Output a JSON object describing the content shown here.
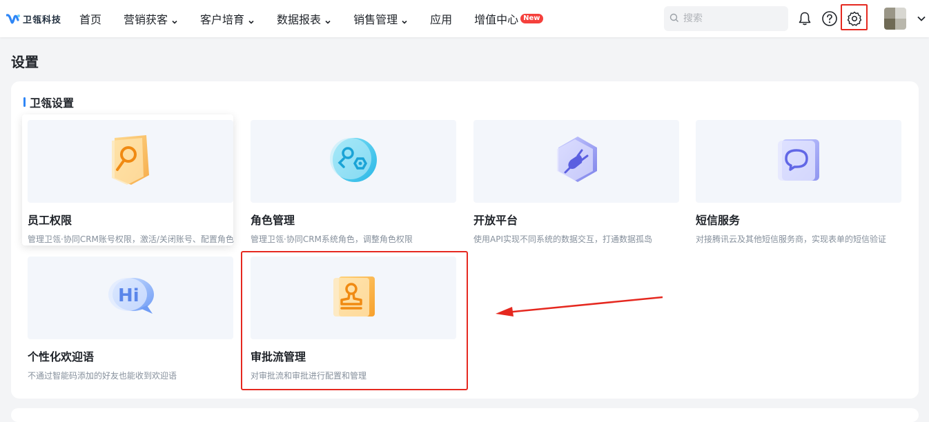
{
  "brand": {
    "name": "卫瓴科技",
    "accent": "#2f86f6"
  },
  "nav": {
    "items": [
      {
        "label": "首页",
        "dropdown": false
      },
      {
        "label": "营销获客",
        "dropdown": true
      },
      {
        "label": "客户培育",
        "dropdown": true
      },
      {
        "label": "数据报表",
        "dropdown": true
      },
      {
        "label": "销售管理",
        "dropdown": true
      },
      {
        "label": "应用",
        "dropdown": false
      },
      {
        "label": "增值中心",
        "dropdown": false,
        "badge": "New"
      }
    ]
  },
  "search": {
    "placeholder": "搜索",
    "value": ""
  },
  "toolbar": {
    "icons": [
      "bell-icon",
      "help-icon",
      "settings-icon",
      "chevron-down-icon"
    ]
  },
  "page": {
    "title": "设置"
  },
  "section": {
    "title": "卫瓴设置",
    "cards": [
      {
        "title": "员工权限",
        "desc": "管理卫瓴·协同CRM账号权限，激活/关闭账号、配置角色",
        "icon": "key-icon"
      },
      {
        "title": "角色管理",
        "desc": "管理卫瓴·协同CRM系统角色，调整角色权限",
        "icon": "roles-icon"
      },
      {
        "title": "开放平台",
        "desc": "使用API实现不同系统的数据交互，打通数据孤岛",
        "icon": "plug-icon"
      },
      {
        "title": "短信服务",
        "desc": "对接腾讯云及其他短信服务商，实现表单的短信验证",
        "icon": "message-icon"
      },
      {
        "title": "个性化欢迎语",
        "desc": "不通过智能码添加的好友也能收到欢迎语",
        "icon": "hi-bubble-icon"
      },
      {
        "title": "审批流管理",
        "desc": "对审批流和审批进行配置和管理",
        "icon": "stamp-icon"
      }
    ]
  },
  "colors": {
    "highlight": "#e5281f",
    "badge": "#f5403c"
  }
}
